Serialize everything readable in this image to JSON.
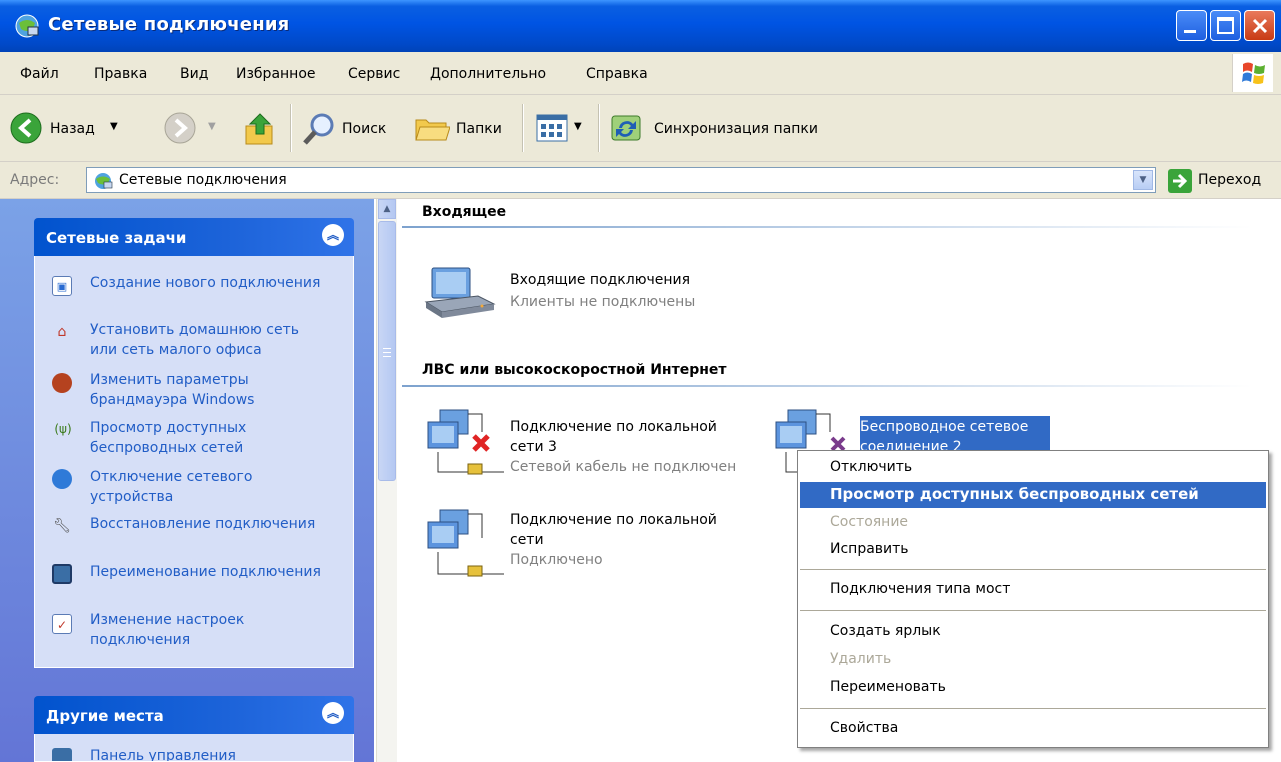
{
  "window": {
    "title": "Сетевые подключения"
  },
  "menu": [
    "Файл",
    "Правка",
    "Вид",
    "Избранное",
    "Сервис",
    "Дополнительно",
    "Справка"
  ],
  "toolbar": {
    "back": "Назад",
    "search": "Поиск",
    "folders": "Папки",
    "sync": "Синхронизация папки"
  },
  "address": {
    "label": "Адрес:",
    "value": "Сетевые подключения",
    "go": "Переход"
  },
  "network_tasks": {
    "title": "Сетевые задачи",
    "items": [
      "Создание нового подключения",
      "Установить домашнюю сеть или сеть малого офиса",
      "Изменить параметры брандмауэра Windows",
      "Просмотр доступных беспроводных сетей",
      "Отключение сетевого устройства",
      "Восстановление подключения",
      "Переименование подключения",
      "Изменение настроек подключения"
    ]
  },
  "other_places": {
    "title": "Другие места",
    "first_item": "Панель управления"
  },
  "groups": {
    "incoming": {
      "title": "Входящее",
      "items": [
        {
          "name": "Входящие подключения",
          "status": "Клиенты не подключены"
        }
      ]
    },
    "lan": {
      "title": "ЛВС или высокоскоростной Интернет",
      "items": [
        {
          "name_line1": "Подключение по локальной",
          "name_line2": "сети 3",
          "status": "Сетевой кабель не подключен"
        },
        {
          "name_line1": "Подключение по локальной",
          "name_line2": "сети",
          "status": "Подключено"
        },
        {
          "name_line1": "Беспроводное сетевое",
          "name_line2": "соединение 2"
        }
      ]
    }
  },
  "context_menu": {
    "items": [
      {
        "label": "Отключить"
      },
      {
        "label": "Просмотр доступных беспроводных сетей",
        "bold": true,
        "highlighted": true
      },
      {
        "label": "Состояние",
        "disabled": true
      },
      {
        "label": "Исправить"
      },
      {
        "label": "Подключения типа мост"
      },
      {
        "label": "Создать ярлык"
      },
      {
        "label": "Удалить",
        "disabled": true
      },
      {
        "label": "Переименовать"
      },
      {
        "label": "Свойства"
      }
    ]
  },
  "colors": {
    "titlebar": "#0054e3",
    "highlight": "#316ac5",
    "link": "#215dc6",
    "taskpane": "#6375d6"
  }
}
